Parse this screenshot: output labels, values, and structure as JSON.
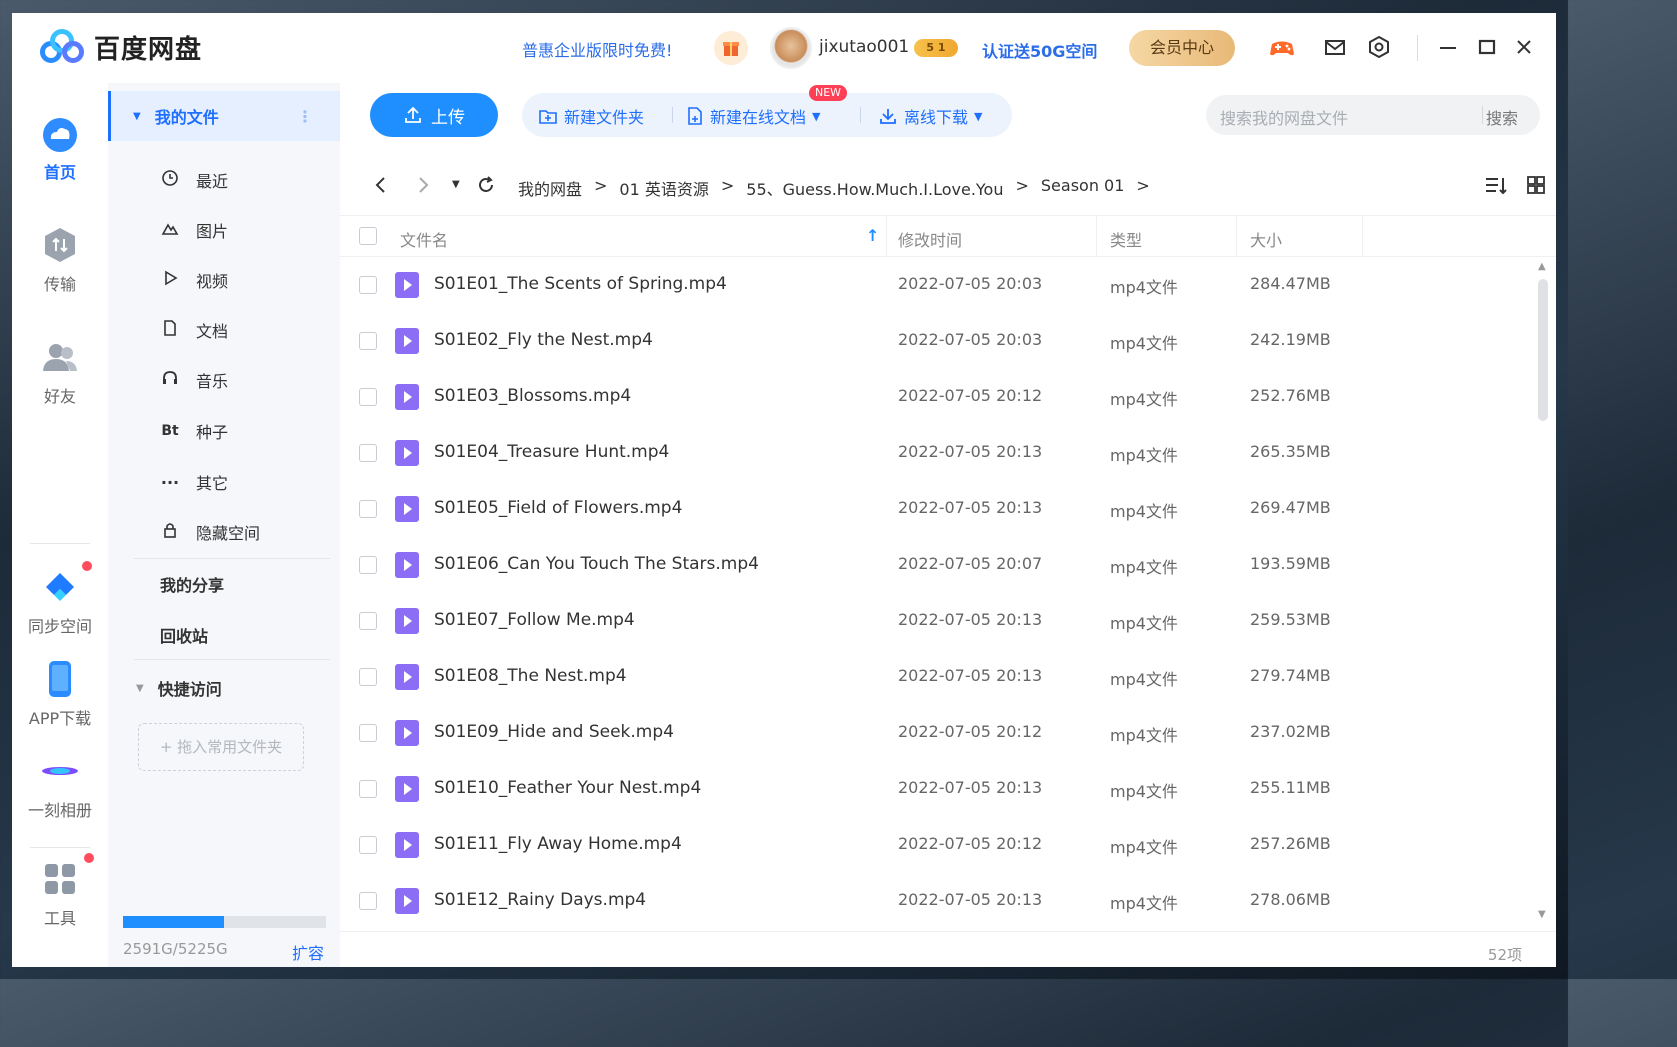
{
  "app": {
    "name": "百度网盘"
  },
  "titlebar": {
    "promo": "普惠企业版限时免费!",
    "username": "jixutao001",
    "level_badge": "5 1",
    "verify": "认证送50G空间",
    "vip_button": "会员中心"
  },
  "rail": {
    "items": [
      {
        "label": "首页",
        "icon": "home-cloud-icon"
      },
      {
        "label": "传输",
        "icon": "transfer-icon"
      },
      {
        "label": "好友",
        "icon": "friends-icon"
      },
      {
        "label": "同步空间",
        "icon": "sync-icon"
      },
      {
        "label": "APP下载",
        "icon": "phone-icon"
      },
      {
        "label": "一刻相册",
        "icon": "album-icon"
      },
      {
        "label": "工具",
        "icon": "tools-icon"
      }
    ]
  },
  "sidebar": {
    "my_files": "我的文件",
    "items": [
      {
        "label": "最近",
        "icon": "clock-icon"
      },
      {
        "label": "图片",
        "icon": "image-icon"
      },
      {
        "label": "视频",
        "icon": "play-icon"
      },
      {
        "label": "文档",
        "icon": "document-icon"
      },
      {
        "label": "音乐",
        "icon": "headphones-icon"
      },
      {
        "label": "种子",
        "icon": "bt-icon",
        "glyph": "Bt"
      },
      {
        "label": "其它",
        "icon": "more-icon"
      },
      {
        "label": "隐藏空间",
        "icon": "lock-icon"
      }
    ],
    "my_share": "我的分享",
    "recycle": "回收站",
    "quick_access": "快捷访问",
    "drop_hint": "+ 拖入常用文件夹",
    "quota": {
      "text": "2591G/5225G",
      "used_fraction": 0.496
    },
    "expand": "扩容"
  },
  "toolbar": {
    "upload": "上传",
    "new_folder": "新建文件夹",
    "new_online_doc": "新建在线文档",
    "new_badge": "NEW",
    "offline_download": "离线下载",
    "search_placeholder": "搜索我的网盘文件",
    "search_button": "搜索"
  },
  "breadcrumb": [
    "我的网盘",
    "01 英语资源",
    "55、Guess.How.Much.I.Love.You",
    "Season 01"
  ],
  "table": {
    "columns": {
      "name": "文件名",
      "modified": "修改时间",
      "type": "类型",
      "size": "大小"
    },
    "rows": [
      {
        "name": "S01E01_The Scents of Spring.mp4",
        "modified": "2022-07-05 20:03",
        "type": "mp4文件",
        "size": "284.47MB"
      },
      {
        "name": "S01E02_Fly the Nest.mp4",
        "modified": "2022-07-05 20:03",
        "type": "mp4文件",
        "size": "242.19MB"
      },
      {
        "name": "S01E03_Blossoms.mp4",
        "modified": "2022-07-05 20:12",
        "type": "mp4文件",
        "size": "252.76MB"
      },
      {
        "name": "S01E04_Treasure Hunt.mp4",
        "modified": "2022-07-05 20:13",
        "type": "mp4文件",
        "size": "265.35MB"
      },
      {
        "name": "S01E05_Field of Flowers.mp4",
        "modified": "2022-07-05 20:13",
        "type": "mp4文件",
        "size": "269.47MB"
      },
      {
        "name": "S01E06_Can You Touch The Stars.mp4",
        "modified": "2022-07-05 20:07",
        "type": "mp4文件",
        "size": "193.59MB"
      },
      {
        "name": "S01E07_Follow Me.mp4",
        "modified": "2022-07-05 20:13",
        "type": "mp4文件",
        "size": "259.53MB"
      },
      {
        "name": "S01E08_The Nest.mp4",
        "modified": "2022-07-05 20:13",
        "type": "mp4文件",
        "size": "279.74MB"
      },
      {
        "name": "S01E09_Hide and Seek.mp4",
        "modified": "2022-07-05 20:12",
        "type": "mp4文件",
        "size": "237.02MB"
      },
      {
        "name": "S01E10_Feather Your Nest.mp4",
        "modified": "2022-07-05 20:13",
        "type": "mp4文件",
        "size": "255.11MB"
      },
      {
        "name": "S01E11_Fly Away Home.mp4",
        "modified": "2022-07-05 20:12",
        "type": "mp4文件",
        "size": "257.26MB"
      },
      {
        "name": "S01E12_Rainy Days.mp4",
        "modified": "2022-07-05 20:13",
        "type": "mp4文件",
        "size": "278.06MB"
      }
    ]
  },
  "footer": {
    "count": "52项"
  },
  "colors": {
    "accent": "#1f8fff",
    "link": "#1f6fff",
    "file_icon": "#8c6df5",
    "alert": "#ff4d5f"
  }
}
